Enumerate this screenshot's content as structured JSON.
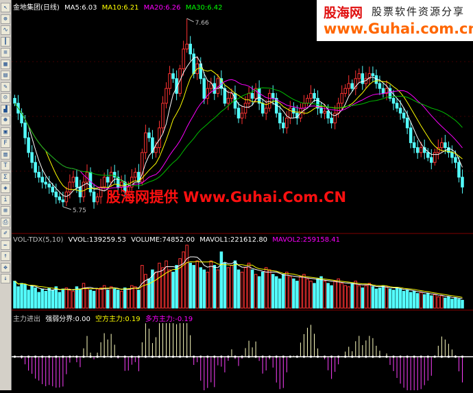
{
  "toolbar": {
    "icons": [
      "cursor-icon",
      "zoom-icon",
      "line-chart-icon",
      "candle-icon",
      "list-icon",
      "grid-icon",
      "table-icon",
      "note-icon",
      "person-icon",
      "chart-icon",
      "people-icon",
      "window-icon",
      "f10-icon",
      "bars-icon",
      "text-icon",
      "stat-icon",
      "market-icon",
      "info-icon",
      "calc-icon",
      "print-icon",
      "edit-icon",
      "pen-icon",
      "up-arrow-icon",
      "cross-icon",
      "down-arrow-icon"
    ]
  },
  "colors": {
    "up": "#ff3232",
    "down": "#54ffff",
    "ma5": "#ffffff",
    "ma10": "#ffff00",
    "ma20": "#ff00ff",
    "ma30": "#00c000",
    "grid": "#800000"
  },
  "price_legend": {
    "name": "金地集团(日线)",
    "ma5": "MA5:6.03",
    "ma10": "MA10:6.21",
    "ma20": "MA20:6.26",
    "ma30": "MA30:6.42"
  },
  "vol_legend": {
    "name": "VOL-TDX(5,10)",
    "vvol": "VVOL:139259.53",
    "volume": "VOLUME:74852.00",
    "mavol1": "MAVOL1:221612.80",
    "mavol2": "MAVOL2:259158.41"
  },
  "ind_legend": {
    "name": "主力进出",
    "a": "强弱分界:0.00",
    "b": "空方主力:0.19",
    "c": "多方主力:-0.19"
  },
  "banner": {
    "logo": "股海网",
    "tagline": "股票软件资源分享",
    "url": "www.Guhai.com.cn"
  },
  "watermark": "股海网提供 Www.Guhai.Com.CN",
  "chart_data": {
    "type": "candlestick",
    "price_range": [
      5.5,
      7.75
    ],
    "annotations": [
      {
        "label": "7.66",
        "value": 7.66
      },
      {
        "label": "5.75",
        "value": 5.75
      }
    ],
    "close": [
      6.8,
      6.7,
      6.6,
      6.45,
      6.3,
      6.2,
      6.1,
      6.05,
      6.0,
      5.98,
      5.95,
      5.9,
      5.85,
      5.82,
      5.8,
      5.9,
      6.0,
      6.05,
      5.95,
      5.85,
      6.0,
      6.1,
      5.9,
      5.8,
      5.85,
      5.95,
      6.05,
      6.0,
      6.1,
      6.05,
      5.95,
      6.0,
      5.9,
      5.95,
      6.05,
      6.1,
      6.0,
      6.3,
      6.5,
      6.45,
      6.3,
      6.35,
      6.55,
      6.8,
      6.95,
      7.1,
      7.05,
      6.9,
      7.15,
      7.35,
      7.4,
      7.3,
      7.1,
      7.2,
      7.05,
      6.85,
      6.95,
      7.0,
      6.9,
      7.05,
      6.95,
      6.8,
      6.85,
      6.9,
      6.75,
      6.65,
      6.7,
      6.8,
      6.9,
      6.85,
      6.95,
      6.8,
      6.7,
      6.75,
      6.9,
      6.85,
      6.7,
      6.6,
      6.55,
      6.65,
      6.75,
      6.7,
      6.65,
      6.75,
      6.8,
      6.85,
      6.9,
      6.85,
      6.75,
      6.7,
      6.72,
      6.65,
      6.6,
      6.7,
      6.8,
      6.9,
      6.95,
      7.0,
      6.95,
      7.05,
      7.1,
      7.0,
      7.05,
      7.1,
      7.08,
      7.0,
      6.95,
      6.9,
      6.95,
      6.85,
      6.8,
      6.75,
      6.7,
      6.65,
      6.55,
      6.4,
      6.35,
      6.3,
      6.35,
      6.3,
      6.25,
      6.2,
      6.3,
      6.35,
      6.4,
      6.35,
      6.3,
      6.25,
      6.2,
      6.05,
      5.95
    ],
    "volume": [
      120,
      95,
      110,
      105,
      80,
      100,
      90,
      70,
      85,
      75,
      90,
      80,
      95,
      70,
      85,
      90,
      80,
      75,
      95,
      85,
      110,
      90,
      80,
      75,
      85,
      90,
      100,
      80,
      95,
      85,
      80,
      75,
      90,
      85,
      100,
      95,
      80,
      190,
      150,
      130,
      170,
      160,
      200,
      180,
      210,
      170,
      160,
      190,
      220,
      250,
      280,
      200,
      190,
      210,
      180,
      170,
      160,
      210,
      190,
      170,
      250,
      200,
      180,
      190,
      210,
      170,
      160,
      180,
      200,
      170,
      150,
      140,
      160,
      180,
      170,
      150,
      140,
      130,
      150,
      160,
      140,
      130,
      120,
      140,
      150,
      130,
      120,
      110,
      130,
      140,
      120,
      110,
      100,
      120,
      130,
      110,
      100,
      95,
      110,
      120,
      100,
      90,
      100,
      110,
      95,
      85,
      90,
      100,
      95,
      85,
      80,
      90,
      85,
      75,
      80,
      70,
      75,
      65,
      70,
      60,
      65,
      55,
      60,
      50,
      55,
      45,
      50,
      40,
      45,
      40,
      35
    ],
    "volume_max": 280,
    "indicator_range": [
      -0.6,
      0.6
    ]
  }
}
